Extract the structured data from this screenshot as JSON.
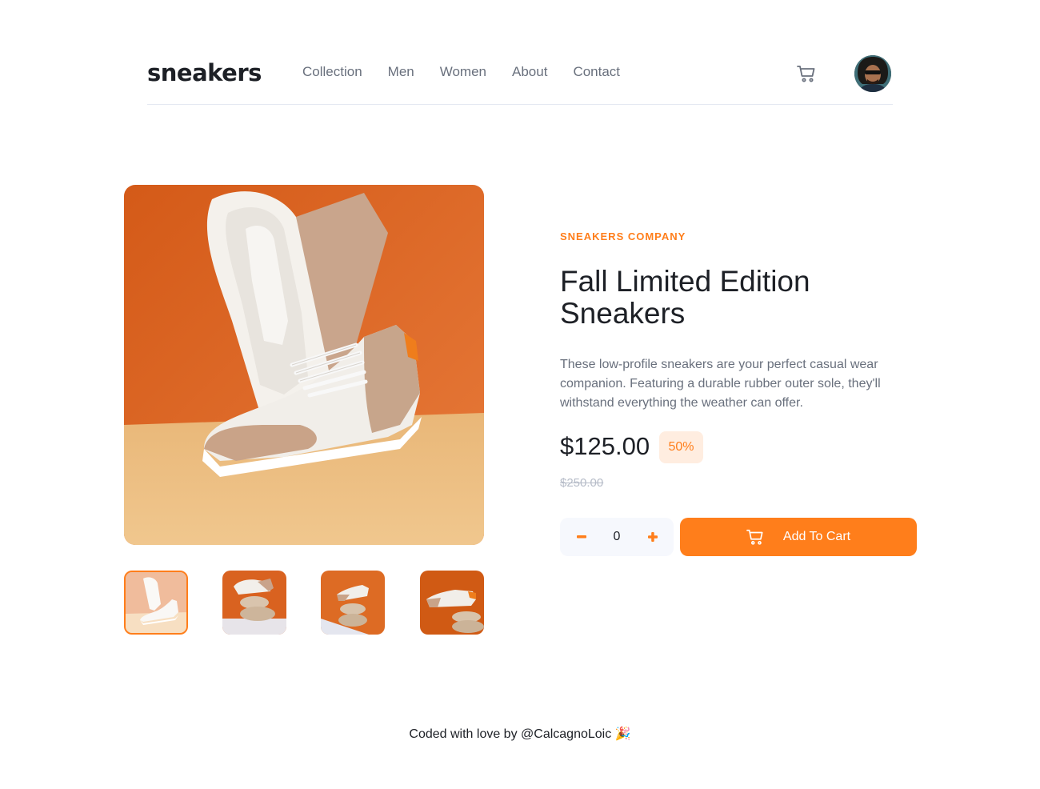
{
  "header": {
    "logo": "sneakers",
    "nav": [
      {
        "label": "Collection"
      },
      {
        "label": "Men"
      },
      {
        "label": "Women"
      },
      {
        "label": "About"
      },
      {
        "label": "Contact"
      }
    ],
    "cart_icon": "cart-icon",
    "avatar_icon": "avatar"
  },
  "product": {
    "company": "SNEAKERS COMPANY",
    "title": "Fall Limited Edition Sneakers",
    "description": "These low-profile sneakers are your perfect casual wear companion. Featuring a durable rubber outer sole, they'll withstand everything the weather can offer.",
    "price": "$125.00",
    "discount": "50%",
    "old_price": "$250.00",
    "quantity": "0",
    "add_to_cart_label": "Add To Cart",
    "thumbnails": 4,
    "active_thumbnail": 1
  },
  "footer": {
    "text": "Coded with love by @CalcagnoLoic 🎉"
  },
  "colors": {
    "accent": "#ff7e1b",
    "accent_light": "#ffede0",
    "text_dark": "#1d2026",
    "text_gray": "#69707d"
  }
}
